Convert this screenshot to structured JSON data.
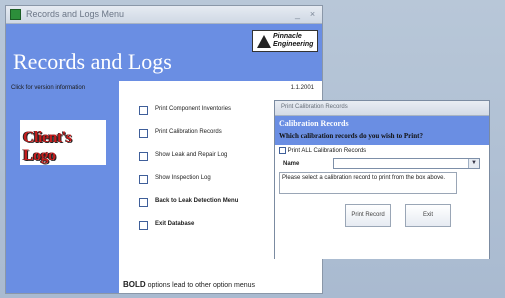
{
  "main_window": {
    "title": "Records and Logs Menu",
    "minimize": "_",
    "close": "×",
    "logo_text": "Pinnacle Engineering",
    "heading": "Records and Logs",
    "version_info": "Click for version information",
    "date": "1.1.2001",
    "client_logo": "Client's Logo",
    "options": [
      {
        "label": "Print Component Inventories",
        "bold": false
      },
      {
        "label": "Print Calibration Records",
        "bold": false
      },
      {
        "label": "Show Leak and Repair Log",
        "bold": false
      },
      {
        "label": "Show Inspection Log",
        "bold": false
      },
      {
        "label": "Back to Leak Detection Menu",
        "bold": true
      },
      {
        "label": "Exit Database",
        "bold": true
      }
    ],
    "footer_bold": "BOLD",
    "footer_rest": " options lead to other option menus"
  },
  "dialog": {
    "title": "Print Calibration Records",
    "heading": "Calibration Records",
    "question": "Which calibration records do you wish to Print?",
    "print_all_label": "Print ALL Calibration Records",
    "name_label": "Name",
    "select_value": "",
    "dropdown_arrow": "▼",
    "message": "Please select a calibration record to print from the box above.",
    "print_button": "Print Record",
    "exit_button": "Exit"
  },
  "icons": {
    "app": "access-form-icon",
    "logo": "pinnacle-logo-icon"
  },
  "colors": {
    "header_blue": "#6a8ee3",
    "client_logo_red": "#c41d1d"
  }
}
